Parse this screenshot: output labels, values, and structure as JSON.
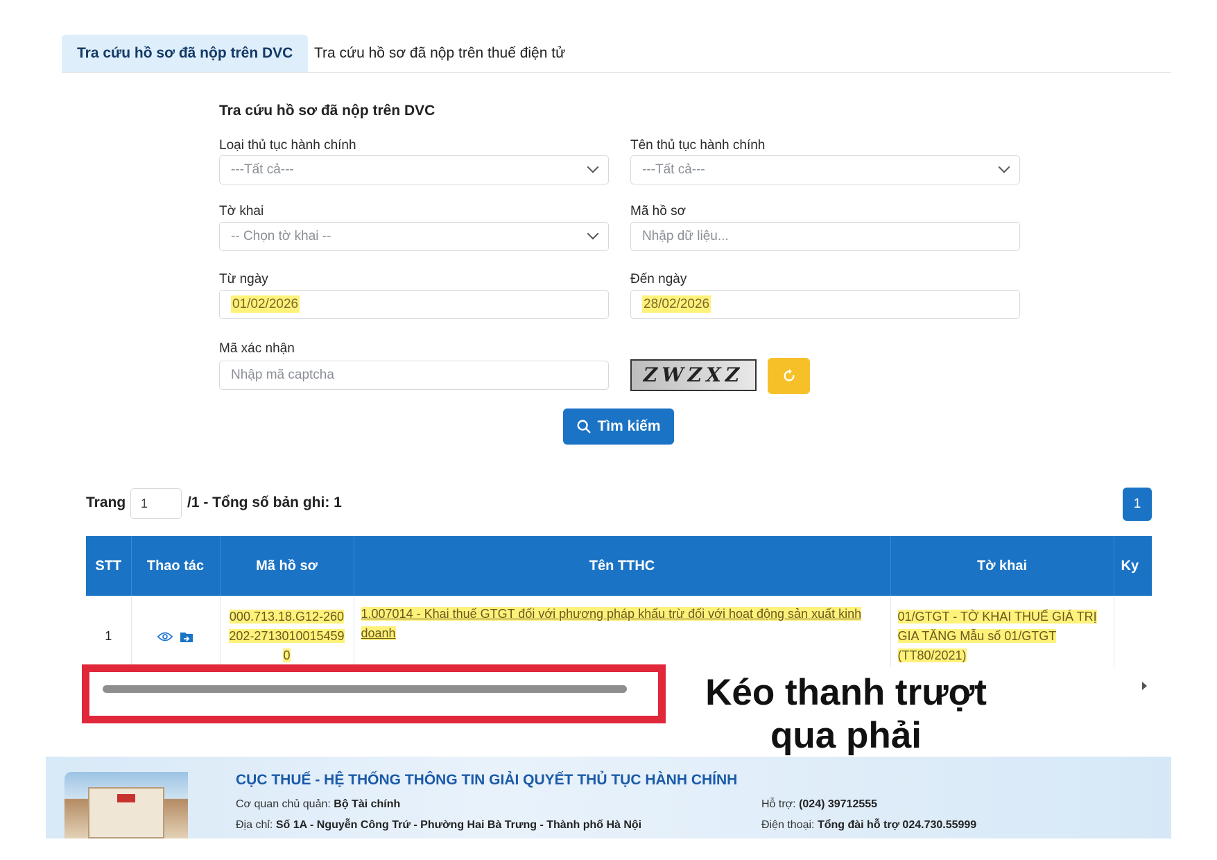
{
  "tabs": {
    "active": "Tra cứu hồ sơ đã nộp trên DVC",
    "inactive": "Tra cứu hồ sơ đã nộp trên thuế điện tử"
  },
  "form": {
    "title": "Tra cứu hồ sơ đã nộp trên DVC",
    "loai_label": "Loại thủ tục hành chính",
    "loai_value": "---Tất cả---",
    "ten_label": "Tên thủ tục hành chính",
    "ten_value": "---Tất cả---",
    "tokhai_label": "Tờ khai",
    "tokhai_value": "-- Chọn tờ khai --",
    "mahoso_label": "Mã hồ sơ",
    "mahoso_placeholder": "Nhập dữ liệu...",
    "tungay_label": "Từ ngày",
    "tungay_value": "01/02/2026",
    "denngay_label": "Đến ngày",
    "denngay_value": "28/02/2026",
    "captcha_label": "Mã xác nhận",
    "captcha_placeholder": "Nhập mã captcha",
    "captcha_text": "ZWZXZ",
    "search_label": "Tìm kiếm"
  },
  "pager": {
    "label": "Trang",
    "current": "1",
    "total_text": "/1 - Tổng số bản ghi: 1",
    "page_button": "1"
  },
  "table": {
    "headers": [
      "STT",
      "Thao tác",
      "Mã hồ sơ",
      "Tên TTHC",
      "Tờ khai",
      "Ky"
    ],
    "row": {
      "stt": "1",
      "ma_ho_so": "000.713.18.G12-260202-27130100154590",
      "ten_tthc": "1.007014 - Khai thuế GTGT đối với phương pháp khấu trừ đối với hoạt động sản xuất kinh doanh",
      "to_khai": "01/GTGT - TỜ KHAI THUẾ GIÁ TRỊ GIA TĂNG Mẫu số 01/GTGT (TT80/2021)"
    }
  },
  "annotation": {
    "line1": "Kéo thanh trượt",
    "line2": "qua phải"
  },
  "footer": {
    "title": "CỤC THUẾ - HỆ THỐNG THÔNG TIN GIẢI QUYẾT THỦ TỤC HÀNH CHÍNH",
    "owner_label": "Cơ quan chủ quản:",
    "owner_value": "Bộ Tài chính",
    "address_label": "Địa chỉ:",
    "address_value": "Số 1A - Nguyễn Công Trứ - Phường Hai Bà Trưng - Thành phố Hà Nội",
    "support_label": "Hỗ trợ:",
    "support_value": "(024) 39712555",
    "phone_label": "Điện thoại:",
    "phone_value": "Tổng đài hỗ trợ 024.730.55999"
  },
  "colors": {
    "primary": "#1a73c5",
    "accent_yellow": "#f6c029",
    "highlight": "#fff27a",
    "annotation_red": "#e0283a"
  },
  "icons": [
    "chevron-down-icon",
    "refresh-icon",
    "search-icon",
    "eye-icon",
    "folder-icon",
    "scroll-right-icon"
  ]
}
